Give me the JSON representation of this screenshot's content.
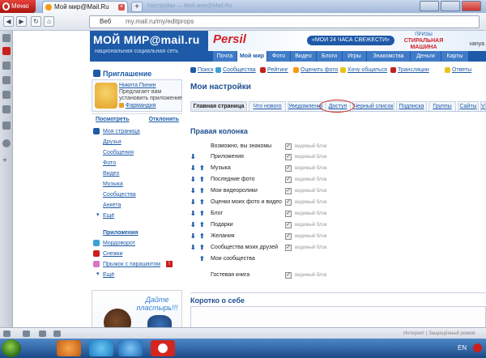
{
  "browser": {
    "menu_label": "Меню",
    "tab_title": "Мой мир@Mail.Ru",
    "new_tab": "+",
    "title_gray": "Настройки — Мой мир@Mail.Ru",
    "url_prefix": "Веб",
    "url": "my.mail.ru/my/editprops",
    "status_text": "Интернет | Защищённый режим"
  },
  "header": {
    "logo": "МОЙ МИР@mail.ru",
    "logo_sub": "национальная социальная сеть",
    "ad_brand": "Persil",
    "ad_slogan": "«МОИ 24 ЧАСА СВЕЖЕСТИ»",
    "ad_prizes": "ПРИЗЫ",
    "ad_prize1": "СТИРАЛЬНАЯ",
    "ad_prize2": "МАШИНА",
    "user": "vanya",
    "tabs": [
      "Почта",
      "Мой мир",
      "Фото",
      "Видео",
      "Блоги",
      "Игры",
      "Знакомства",
      "Деньги",
      "Карты"
    ]
  },
  "quick_links": [
    "Поиск",
    "Сообщества",
    "Рейтинг",
    "Оценить фото",
    "Хочу общаться",
    "Трансляции",
    "Ответы"
  ],
  "invite": {
    "title": "Приглашение",
    "name": "Никита Пинин",
    "message": "Предлагает вам установить приложение",
    "app": "Фармандия",
    "view": "Посмотреть",
    "reject": "Отклонить"
  },
  "left_nav": [
    "Моя страница",
    "Друзья",
    "Сообщения",
    "Фото",
    "Видео",
    "Музыка",
    "Сообщества",
    "Анкета",
    "Ещё"
  ],
  "apps": {
    "title": "Приложения",
    "items": [
      "Мордоворот",
      "Снежки",
      "Прыжок с парашютом",
      "Ещё"
    ]
  },
  "ad_bottom": {
    "text": "Дайте пластырь!!!"
  },
  "main": {
    "title": "Мои настройки",
    "tabs": [
      "Главная страница",
      "Что нового",
      "Уведомления",
      "Доступ",
      "Черный список",
      "Подписка",
      "Группы",
      "Сайты",
      "VIP"
    ],
    "section_title": "Правая колонка",
    "visible_label": "видимый блок",
    "rows": [
      "Возможно, вы знакомы",
      "Приложения",
      "Музыка",
      "Последние фото",
      "Мои видеоролики",
      "Оценки моих фото и видео",
      "Блог",
      "Подарки",
      "Желания",
      "Сообщества моих друзей",
      "Мои сообщества",
      "Гостевая книга"
    ],
    "about_title": "Коротко о себе"
  },
  "taskbar": {
    "lang": "EN"
  },
  "colors": {
    "brand": "#1d5aa8",
    "accent_red": "#c8201c"
  }
}
